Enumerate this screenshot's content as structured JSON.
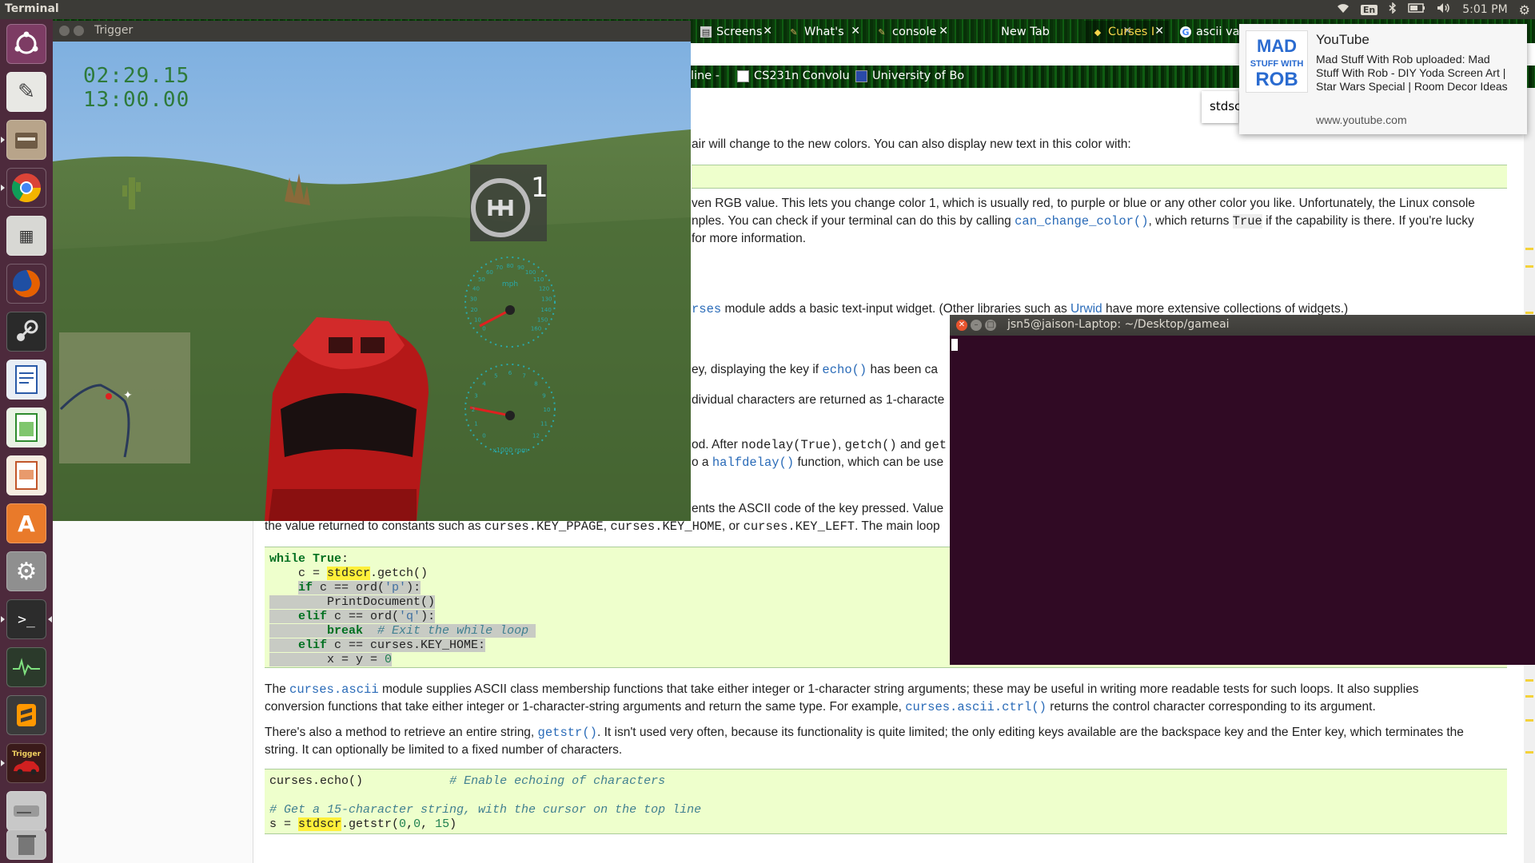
{
  "top_panel": {
    "app_title": "Terminal",
    "keyboard": "En",
    "time": "5:01 PM"
  },
  "launcher": {
    "items": [
      "ubuntu-dash",
      "text-editor",
      "file-manager",
      "chrome",
      "calculator",
      "firefox",
      "steam",
      "writer",
      "calc",
      "impress",
      "software-center",
      "system-settings",
      "terminal",
      "system-monitor",
      "sublime-text",
      "trigger",
      "disk",
      "trash"
    ],
    "trigger_label": "Trigger"
  },
  "browser": {
    "tabs": [
      {
        "label": "Screens"
      },
      {
        "label": "What's"
      },
      {
        "label": "console"
      },
      {
        "label": "New Tab"
      },
      {
        "label": "Curses I"
      },
      {
        "label": "ascii va"
      }
    ],
    "bookmarks": [
      {
        "label": "line -"
      },
      {
        "label": "CS231n Convolu"
      },
      {
        "label": "University of Bo"
      }
    ],
    "find_text": "stdsc"
  },
  "doc": {
    "p1": "air will change to the new colors. You can also display new text in this color with:",
    "p2a": "ven RGB value. This lets you change color 1, which is usually red, to purple or blue or any other color you like. Unfortunately, the Linux console",
    "p2b_pre": "nples. You can check if your terminal can do this by calling ",
    "p2b_code": "can_change_color()",
    "p2b_mid": ", which returns ",
    "p2b_true": "True",
    "p2b_post": " if the capability is there. If you're lucky",
    "p2c": "for more information.",
    "p3_code": "rses",
    "p3_mid": " module adds a basic text-input widget. (Other libraries such as ",
    "p3_link": "Urwid",
    "p3_post": " have more extensive collections of widgets.)",
    "p4_pre": "ey, displaying the key if ",
    "p4_code": "echo()",
    "p4_post": " has been ca",
    "p5": "dividual characters are returned as 1-characte",
    "p6_pre": "od. After ",
    "p6_c1": "nodelay(True)",
    "p6_c2": "getch()",
    "p6_and": " and ",
    "p6_c3": "get",
    "p7_pre": "o a ",
    "p7_code": "halfdelay()",
    "p7_post": " function, which can be use",
    "p8": "ents the ASCII code of the key pressed. Value",
    "p9_pre": "the value returned to constants such as ",
    "p9_c1": "curses.KEY_PPAGE",
    "p9_c2": "curses.KEY_HOME",
    "p9_or": ", or ",
    "p9_c3": "curses.KEY_LEFT",
    "p9_post": ". The main loop",
    "p10_pre": "The ",
    "p10_code": "curses.ascii",
    "p10_post": " module supplies ASCII class membership functions that take either integer or 1-character string arguments; these may be useful in writing more readable tests for such loops. It also supplies",
    "p10b_pre": "conversion functions that take either integer or 1-character-string arguments and return the same type. For example, ",
    "p10b_code": "curses.ascii.ctrl()",
    "p10b_post": " returns the control character corresponding to its argument.",
    "p11_pre": "There's also a method to retrieve an entire string, ",
    "p11_code": "getstr()",
    "p11_post": ". It isn't used very often, because its functionality is quite limited; the only editing keys available are the backspace key and the Enter key, which terminates the",
    "p11b": "string. It can optionally be limited to a fixed number of characters.",
    "code1": {
      "l1_kw": "while",
      "l1_true": "True",
      "l1_colon": ":",
      "l2_pre": "    c = ",
      "l2_hl": "stdscr",
      "l2_post": ".getch()",
      "l3_kw": "if",
      "l3_post": " c == ord(",
      "l3_str": "'p'",
      "l3_end": "):",
      "l4": "        PrintDocument()",
      "l5_kw": "elif",
      "l5_post": " c == ord(",
      "l5_str": "'q'",
      "l5_end": "):",
      "l6_kw": "break",
      "l6_cm": "# Exit the while loop",
      "l7_kw": "elif",
      "l7_post": " c == curses.KEY_HOME:",
      "l8_pre": "        x = y = ",
      "l8_num": "0"
    },
    "code2": {
      "l1_pre": "curses.echo()",
      "l1_cm": "# Enable echoing of characters",
      "l2_cm": "# Get a 15-character string, with the cursor on the top line",
      "l3_pre": "s = ",
      "l3_hl": "stdscr",
      "l3_mid": ".getstr(",
      "l3_n1": "0",
      "l3_c": ",",
      "l3_n2": "0",
      "l3_sp": ", ",
      "l3_n3": "15",
      "l3_end": ")"
    }
  },
  "notification": {
    "title": "YouTube",
    "body": "Mad Stuff With Rob uploaded: Mad Stuff With Rob - DIY Yoda Screen Art | Star Wars Special | Room Decor Ideas",
    "url": "www.youtube.com",
    "logo_l1": "MAD",
    "logo_l2": "STUFF WITH",
    "logo_l3": "ROB"
  },
  "game": {
    "window_title": "Trigger",
    "time1": "02:29.15",
    "time2": "13:00.00",
    "gear": "1",
    "speed_unit": "mph",
    "rpm_unit": "x1000 rpm",
    "speed_ticks": [
      "0",
      "10",
      "20",
      "30",
      "40",
      "50",
      "60",
      "70",
      "80",
      "90",
      "100",
      "110",
      "120",
      "130",
      "140",
      "150",
      "160"
    ],
    "rpm_ticks": [
      "0",
      "1",
      "2",
      "3",
      "4",
      "5",
      "6",
      "7",
      "8",
      "9",
      "10",
      "11",
      "12"
    ]
  },
  "terminal": {
    "title": "jsn5@jaison-Laptop: ~/Desktop/gameai"
  },
  "colors": {
    "launcher": "#4d2a3c",
    "terminal_bg": "#300a24",
    "code_bg": "#eeffcc",
    "highlight": "#ffef3a",
    "link": "#2a6bb8"
  }
}
